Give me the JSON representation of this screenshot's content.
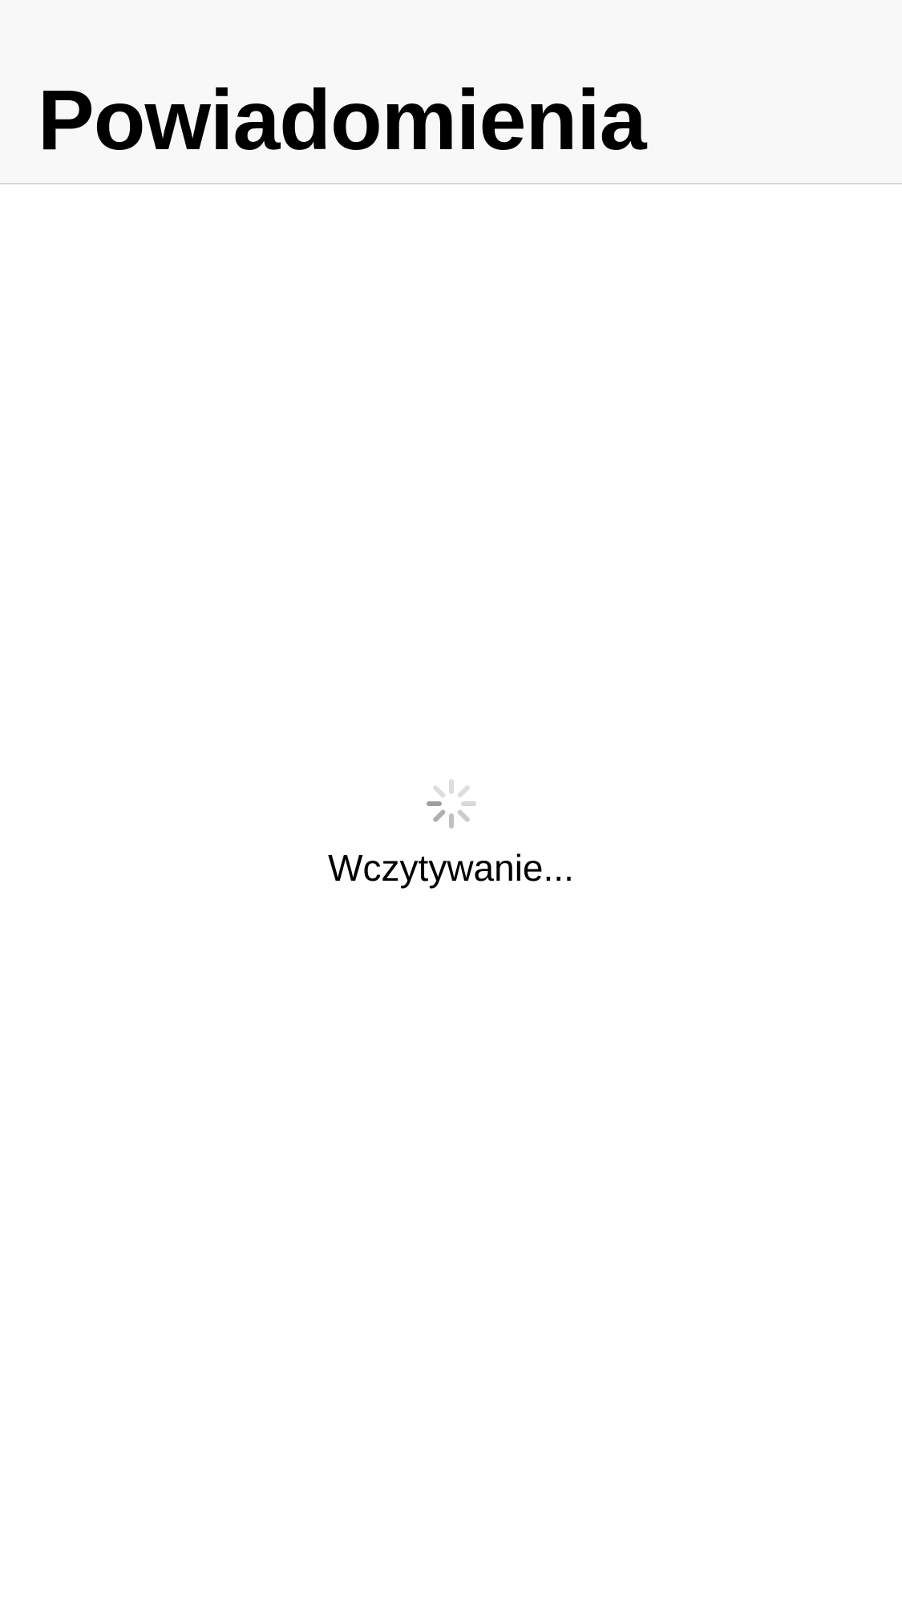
{
  "header": {
    "title": "Powiadomienia"
  },
  "loader": {
    "icon": "spinner-icon",
    "text": "Wczytywanie..."
  },
  "colors": {
    "header_background": "#f8f8f8",
    "header_border": "#d6d6d6",
    "spinner_gray": "#8e8e93",
    "text": "#000000"
  }
}
